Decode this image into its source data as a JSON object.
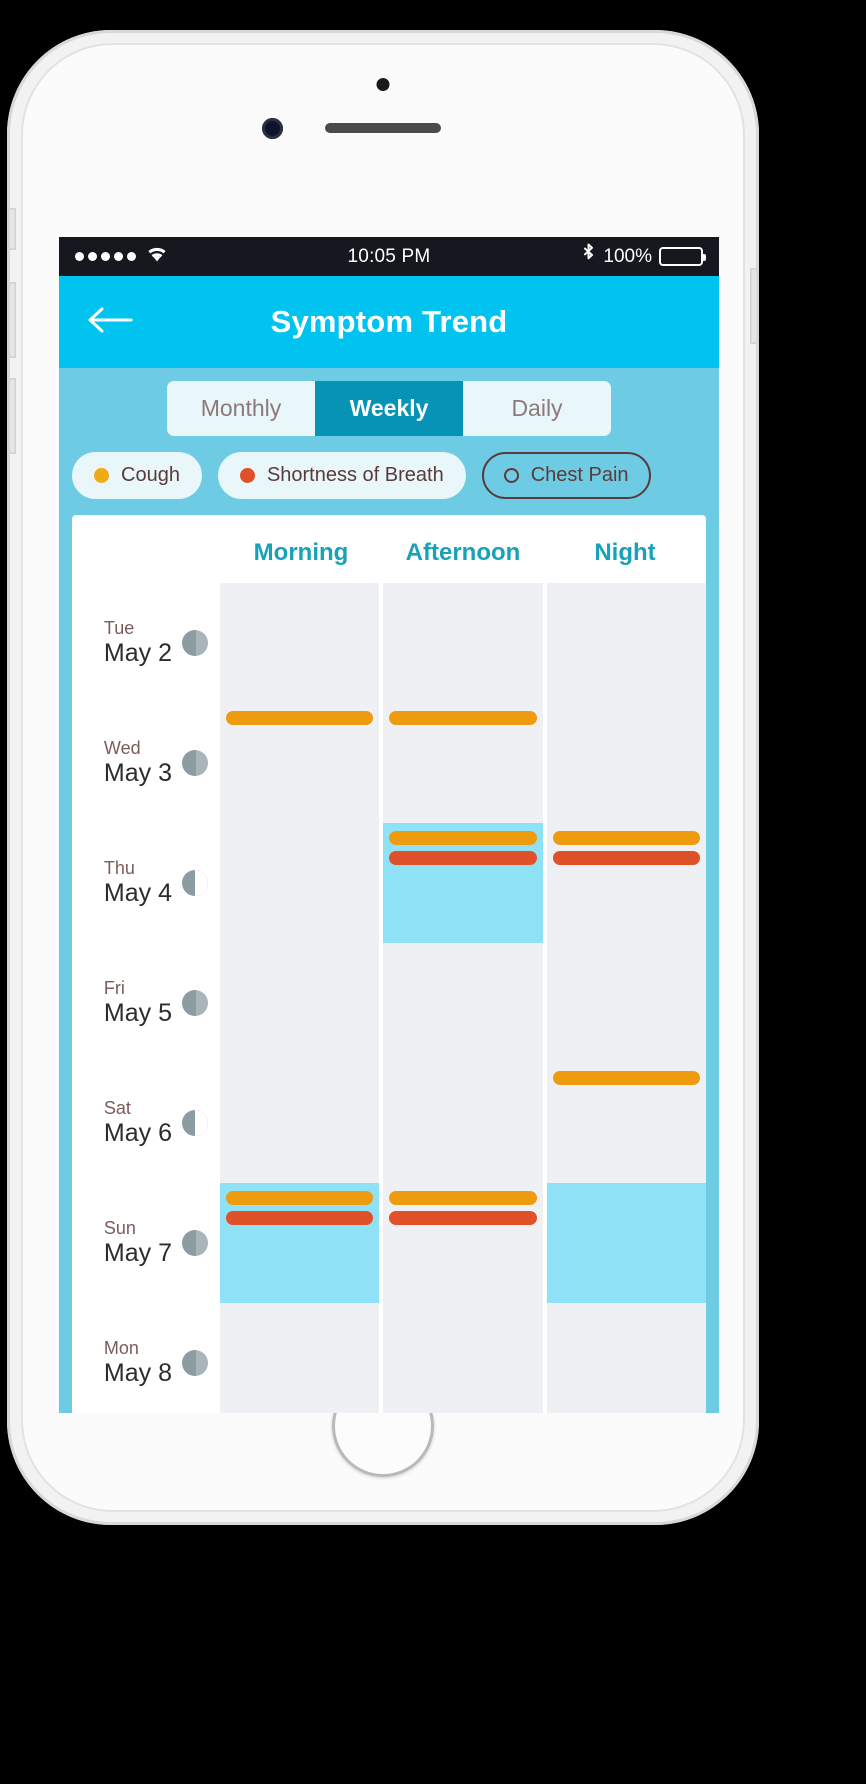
{
  "status_bar": {
    "signal_dots": 5,
    "wifi_icon": "wifi-icon",
    "time": "10:05 PM",
    "bluetooth_icon": "bluetooth-icon",
    "battery_percent": "100%",
    "battery_level": 100
  },
  "nav": {
    "back_icon": "arrow-left-icon",
    "title": "Symptom Trend"
  },
  "segmented": {
    "options": [
      {
        "label": "Monthly",
        "active": false
      },
      {
        "label": "Weekly",
        "active": true
      },
      {
        "label": "Daily",
        "active": false
      }
    ]
  },
  "chips": [
    {
      "label": "Cough",
      "color": "#eeab16",
      "selected": true
    },
    {
      "label": "Shortness of Breath",
      "color": "#e0512a",
      "selected": true
    },
    {
      "label": "Chest Pain",
      "color": "#5a3b3b",
      "selected": false
    }
  ],
  "colors": {
    "accent": "#00c4ef",
    "sub_header": "#6ecbe4",
    "segment_active": "#0693b5",
    "column_title": "#17a2b8",
    "cell_empty": "#eef0f4",
    "cell_highlight": "#8fe2f5",
    "cough": "#ef9b0f",
    "shortness_of_breath": "#e0512a",
    "moon": "#8d9ca1"
  },
  "chart_data": {
    "type": "heatmap",
    "title": "Symptom Trend",
    "xlabel": "",
    "ylabel": "",
    "categories": [
      "Morning",
      "Afternoon",
      "Night"
    ],
    "series": [
      {
        "name": "Cough",
        "color": "#ef9b0f"
      },
      {
        "name": "Shortness of Breath",
        "color": "#e0512a"
      }
    ],
    "rows": [
      {
        "dow": "Tue",
        "date": "May 2",
        "moon": "waning-gibbous",
        "cells": [
          {
            "period": "Morning",
            "highlight": false,
            "bars": []
          },
          {
            "period": "Afternoon",
            "highlight": false,
            "bars": []
          },
          {
            "period": "Night",
            "highlight": false,
            "bars": []
          }
        ]
      },
      {
        "dow": "Wed",
        "date": "May 3",
        "moon": "waning-gibbous",
        "cells": [
          {
            "period": "Morning",
            "highlight": false,
            "bars": [
              "Cough"
            ]
          },
          {
            "period": "Afternoon",
            "highlight": false,
            "bars": [
              "Cough"
            ]
          },
          {
            "period": "Night",
            "highlight": false,
            "bars": []
          }
        ]
      },
      {
        "dow": "Thu",
        "date": "May 4",
        "moon": "last-quarter",
        "cells": [
          {
            "period": "Morning",
            "highlight": false,
            "bars": []
          },
          {
            "period": "Afternoon",
            "highlight": true,
            "bars": [
              "Cough",
              "Shortness of Breath"
            ]
          },
          {
            "period": "Night",
            "highlight": false,
            "bars": [
              "Cough",
              "Shortness of Breath"
            ]
          }
        ]
      },
      {
        "dow": "Fri",
        "date": "May 5",
        "moon": "waning-gibbous",
        "cells": [
          {
            "period": "Morning",
            "highlight": false,
            "bars": []
          },
          {
            "period": "Afternoon",
            "highlight": false,
            "bars": []
          },
          {
            "period": "Night",
            "highlight": false,
            "bars": []
          }
        ]
      },
      {
        "dow": "Sat",
        "date": "May 6",
        "moon": "last-quarter",
        "cells": [
          {
            "period": "Morning",
            "highlight": false,
            "bars": []
          },
          {
            "period": "Afternoon",
            "highlight": false,
            "bars": []
          },
          {
            "period": "Night",
            "highlight": false,
            "bars": [
              "Cough"
            ]
          }
        ]
      },
      {
        "dow": "Sun",
        "date": "May 7",
        "moon": "waning-gibbous",
        "cells": [
          {
            "period": "Morning",
            "highlight": true,
            "bars": [
              "Cough",
              "Shortness of Breath"
            ]
          },
          {
            "period": "Afternoon",
            "highlight": false,
            "bars": [
              "Cough",
              "Shortness of Breath"
            ]
          },
          {
            "period": "Night",
            "highlight": true,
            "bars": []
          }
        ]
      },
      {
        "dow": "Mon",
        "date": "May 8",
        "moon": "waning-gibbous",
        "cells": [
          {
            "period": "Morning",
            "highlight": false,
            "bars": []
          },
          {
            "period": "Afternoon",
            "highlight": false,
            "bars": []
          },
          {
            "period": "Night",
            "highlight": false,
            "bars": []
          }
        ]
      }
    ]
  }
}
